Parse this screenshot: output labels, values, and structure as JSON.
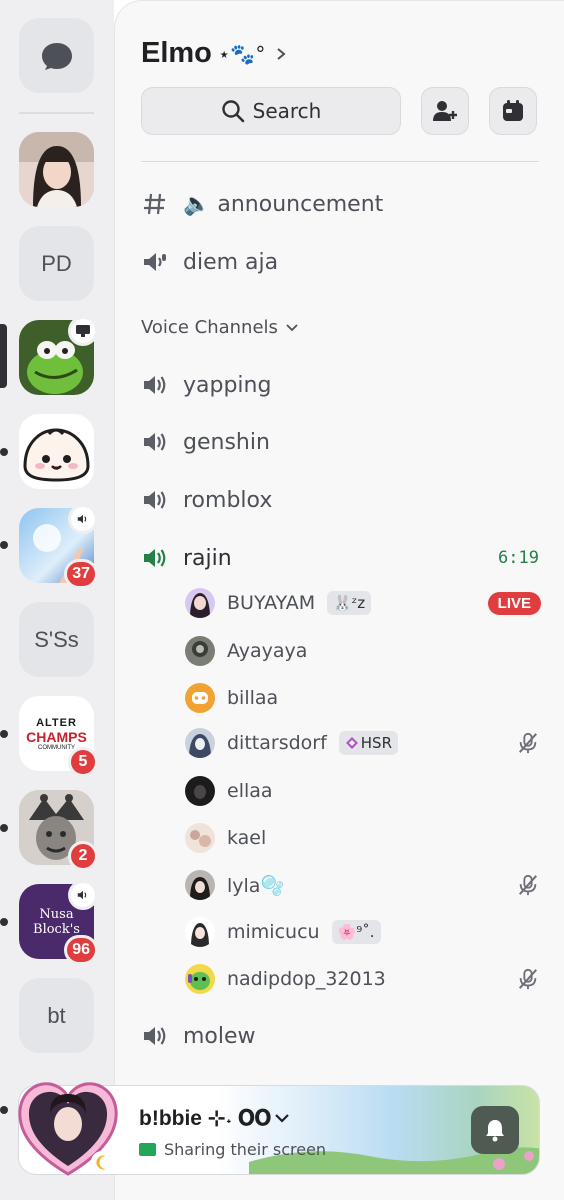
{
  "rail": {
    "servers": [
      {
        "label": "PD"
      },
      {
        "label": "S'Ss"
      },
      {
        "label": "bt"
      }
    ],
    "badges": {
      "s5": "37",
      "s7": "5",
      "s8": "2",
      "s9": "96"
    },
    "thumb_text": {
      "s9_line1": "Nusa",
      "s9_line2": "Block's",
      "s7_line1": "ALTER",
      "s7_line2": "CHAMPS",
      "s7_line3": "COMMUNITY"
    }
  },
  "guild": {
    "name": "Elmo",
    "deco": "⋆🐾°"
  },
  "header": {
    "search_label": "Search"
  },
  "channels": {
    "announcement": "🔈 announcement",
    "diem_aja": "diem aja"
  },
  "category": {
    "label": "Voice Channels"
  },
  "voice": {
    "yapping": "yapping",
    "genshin": "genshin",
    "romblox": "romblox",
    "rajin": "rajin",
    "rajin_timer": "6:19",
    "molew": "molew"
  },
  "members": [
    {
      "name": "BUYAYAM",
      "tag": "🐰ᶻz",
      "live": "LIVE"
    },
    {
      "name": "Ayayaya"
    },
    {
      "name": "billaa"
    },
    {
      "name": "dittarsdorf",
      "tag": "HSR"
    },
    {
      "name": "ellaa"
    },
    {
      "name": "kael"
    },
    {
      "name": "lyla🫧"
    },
    {
      "name": "mimicucu",
      "tag": "🌸⁹˚."
    },
    {
      "name": "nadipdop_32013"
    }
  ],
  "status_card": {
    "username": "b!bbie ⊹˖ 𝐎𝐎",
    "status": "Sharing their screen"
  },
  "colors": {
    "accent_green": "#248046",
    "live_red": "#e03e3e",
    "panel_bg": "#f8f8f9",
    "rail_bg": "#efeff1"
  },
  "icons": [
    "chat-bubble-icon",
    "search-icon",
    "add-member-icon",
    "calendar-icon",
    "hash-icon",
    "speaker-icon",
    "megaphone-icon",
    "chevron-down-icon",
    "muted-mic-icon",
    "bell-icon",
    "screen-share-icon",
    "monitor-icon"
  ]
}
